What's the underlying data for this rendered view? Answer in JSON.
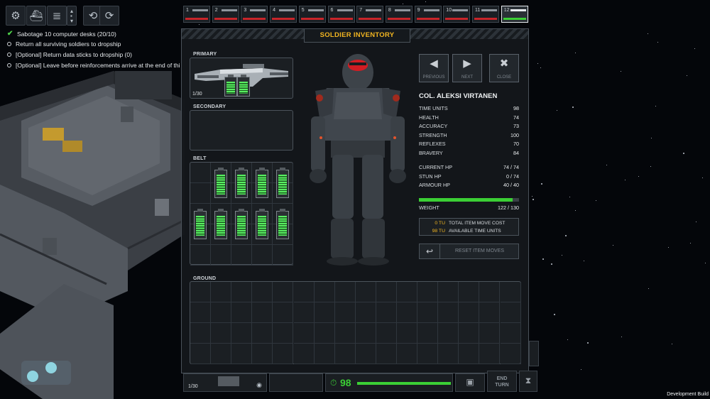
{
  "colors": {
    "accent": "#f2b521",
    "health": "#3bcf35",
    "danger": "#c8252a",
    "tu": "#f2b521"
  },
  "toolbar": {
    "icons": [
      "gear-icon",
      "ship-icon",
      "layers-icon",
      "level-stepper-icon",
      "rotate-icon",
      "eye-rotate-icon"
    ]
  },
  "objectives": [
    {
      "text": "Sabotage 10 computer desks (20/10)",
      "done": true
    },
    {
      "text": "Return all surviving soldiers to dropship",
      "done": false
    },
    {
      "text": "[Optional] Return data sticks to dropship (0)",
      "done": false
    },
    {
      "text": "[Optional] Leave before reinforcements arrive at the end of thi",
      "done": false
    }
  ],
  "soldiers": [
    {
      "num": "1"
    },
    {
      "num": "2"
    },
    {
      "num": "3"
    },
    {
      "num": "4"
    },
    {
      "num": "5"
    },
    {
      "num": "6"
    },
    {
      "num": "7"
    },
    {
      "num": "8"
    },
    {
      "num": "9"
    },
    {
      "num": "10"
    },
    {
      "num": "11"
    },
    {
      "num": "12",
      "active": true
    }
  ],
  "inventory": {
    "title": "SOLDIER INVENTORY",
    "primary_label": "PRIMARY",
    "primary_ammo": "1/30",
    "secondary_label": "SECONDARY",
    "belt_label": "BELT",
    "ground_label": "GROUND"
  },
  "nav": {
    "previous": "PREVIOUS",
    "next": "NEXT",
    "close": "CLOSE"
  },
  "soldier": {
    "name": "COL. ALEKSI VIRTANEN",
    "stats": [
      {
        "label": "TIME UNITS",
        "value": "98"
      },
      {
        "label": "HEALTH",
        "value": "74"
      },
      {
        "label": "ACCURACY",
        "value": "73"
      },
      {
        "label": "STRENGTH",
        "value": "100"
      },
      {
        "label": "REFLEXES",
        "value": "70"
      },
      {
        "label": "BRAVERY",
        "value": "84"
      }
    ],
    "hp": [
      {
        "label": "CURRENT HP",
        "value": "74 / 74"
      },
      {
        "label": "STUN HP",
        "value": "0 / 74"
      },
      {
        "label": "ARMOUR HP",
        "value": "40 / 40"
      }
    ],
    "weight_label": "WEIGHT",
    "weight_value": "122 / 130",
    "weight_fraction": 0.938
  },
  "tu_box": {
    "cost_value": "0 TU",
    "cost_label": "TOTAL ITEM MOVE COST",
    "avail_value": "98 TU",
    "avail_label": "AVAILABLE TIME UNITS"
  },
  "reset_label": "RESET ITEM MOVES",
  "hud": {
    "ammo": "1/30",
    "tu": "98",
    "end_turn": "END TURN",
    "tu_fraction": 1.0
  },
  "dev_build": "Development Build"
}
